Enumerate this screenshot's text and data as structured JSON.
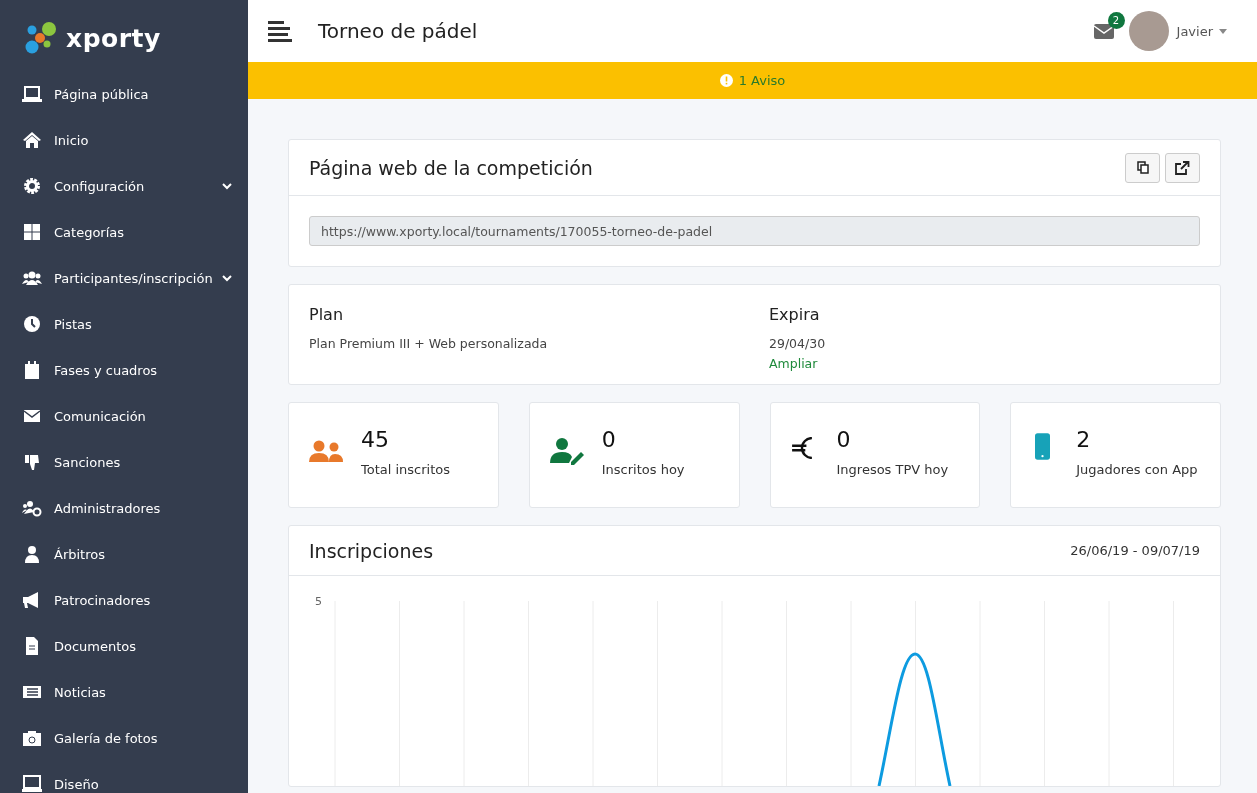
{
  "brand": {
    "name": "xporty"
  },
  "sidebar": {
    "items": [
      {
        "label": "Página pública",
        "expandable": false
      },
      {
        "label": "Inicio",
        "expandable": false
      },
      {
        "label": "Configuración",
        "expandable": true
      },
      {
        "label": "Categorías",
        "expandable": false
      },
      {
        "label": "Participantes/inscripción",
        "expandable": true
      },
      {
        "label": "Pistas",
        "expandable": false
      },
      {
        "label": "Fases y cuadros",
        "expandable": false
      },
      {
        "label": "Comunicación",
        "expandable": false
      },
      {
        "label": "Sanciones",
        "expandable": false
      },
      {
        "label": "Administradores",
        "expandable": false
      },
      {
        "label": "Árbitros",
        "expandable": false
      },
      {
        "label": "Patrocinadores",
        "expandable": false
      },
      {
        "label": "Documentos",
        "expandable": false
      },
      {
        "label": "Noticias",
        "expandable": false
      },
      {
        "label": "Galería de fotos",
        "expandable": false
      },
      {
        "label": "Diseño",
        "expandable": false
      }
    ]
  },
  "header": {
    "title": "Torneo de pádel",
    "messages_badge": "2",
    "user": "Javier"
  },
  "alert": {
    "text": "1 Aviso"
  },
  "website_card": {
    "title": "Página web de la competición",
    "url": "https://www.xporty.local/tournaments/170055-torneo-de-padel"
  },
  "plan_card": {
    "plan_label": "Plan",
    "plan_value": "Plan Premium III + Web personalizada",
    "expires_label": "Expira",
    "expires_value": "29/04/30",
    "extend_link": "Ampliar"
  },
  "stats": [
    {
      "kind": "users",
      "value": "45",
      "label": "Total inscritos",
      "color": "#e8792b"
    },
    {
      "kind": "user-edit",
      "value": "0",
      "label": "Inscritos hoy",
      "color": "#10773f"
    },
    {
      "kind": "euro",
      "value": "0",
      "label": "Ingresos TPV hoy",
      "color": "#111111"
    },
    {
      "kind": "phone",
      "value": "2",
      "label": "Jugadores con App",
      "color": "#17a2b8"
    }
  ],
  "registrations_card": {
    "title": "Inscripciones",
    "date_range": "26/06/19 - 09/07/19",
    "chart_top_tick": "5"
  }
}
